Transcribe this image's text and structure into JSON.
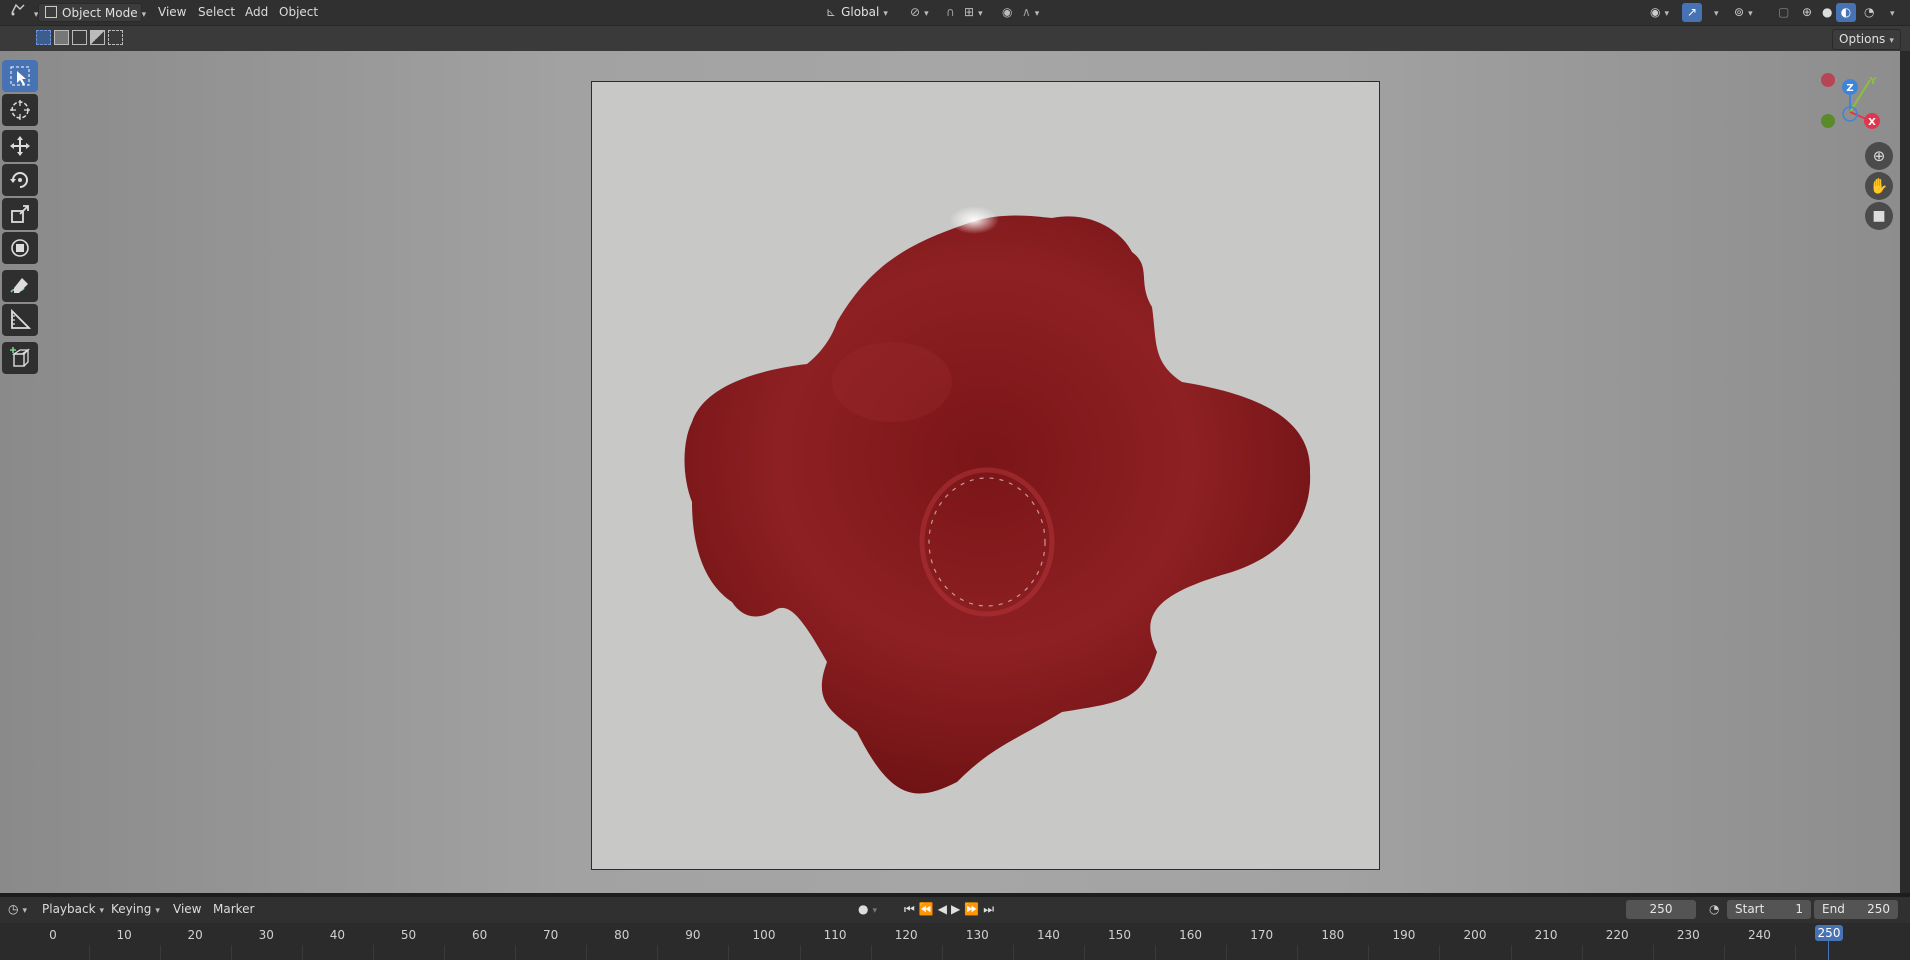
{
  "header": {
    "editor_type_icon": "3d-viewport-icon",
    "mode": "Object Mode",
    "menus": [
      "View",
      "Select",
      "Add",
      "Object"
    ],
    "transform_orientation": "Global",
    "options_label": "Options"
  },
  "gizmo": {
    "z_label": "Z",
    "y_label": "Y",
    "x_label": "X"
  },
  "timeline": {
    "menus": [
      "Playback",
      "Keying",
      "View",
      "Marker"
    ],
    "current_frame": "250",
    "start_label": "Start",
    "start_value": "1",
    "end_label": "End",
    "end_value": "250",
    "ruler_labels": [
      "0",
      "10",
      "20",
      "30",
      "40",
      "50",
      "60",
      "70",
      "80",
      "90",
      "100",
      "110",
      "120",
      "130",
      "140",
      "150",
      "160",
      "170",
      "180",
      "190",
      "200",
      "210",
      "220",
      "230",
      "240"
    ],
    "playhead_label": "250"
  },
  "colors": {
    "accent": "#4772b3",
    "blob": "#8b1c1f",
    "x_axis": "#e0364f",
    "y_axis": "#8bc13a",
    "z_axis": "#3d85d8"
  }
}
